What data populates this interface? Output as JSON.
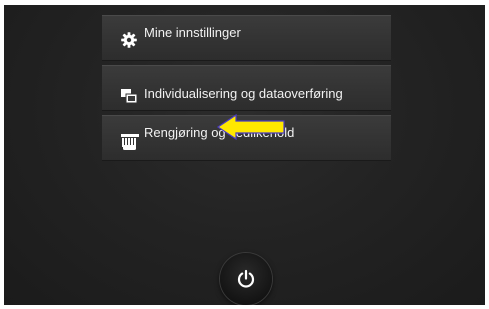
{
  "menu": {
    "items": [
      {
        "label": "Mine innstillinger",
        "icon": "gear-icon"
      },
      {
        "label": "Individualisering og dataoverføring",
        "icon": "data-transfer-icon"
      },
      {
        "label": "Rengjøring og vedlikehold",
        "icon": "cleaning-hand-icon"
      }
    ]
  },
  "annotation": {
    "icon": "arrow-left-icon",
    "color": "#ffe800"
  },
  "power": {
    "icon": "power-icon"
  }
}
